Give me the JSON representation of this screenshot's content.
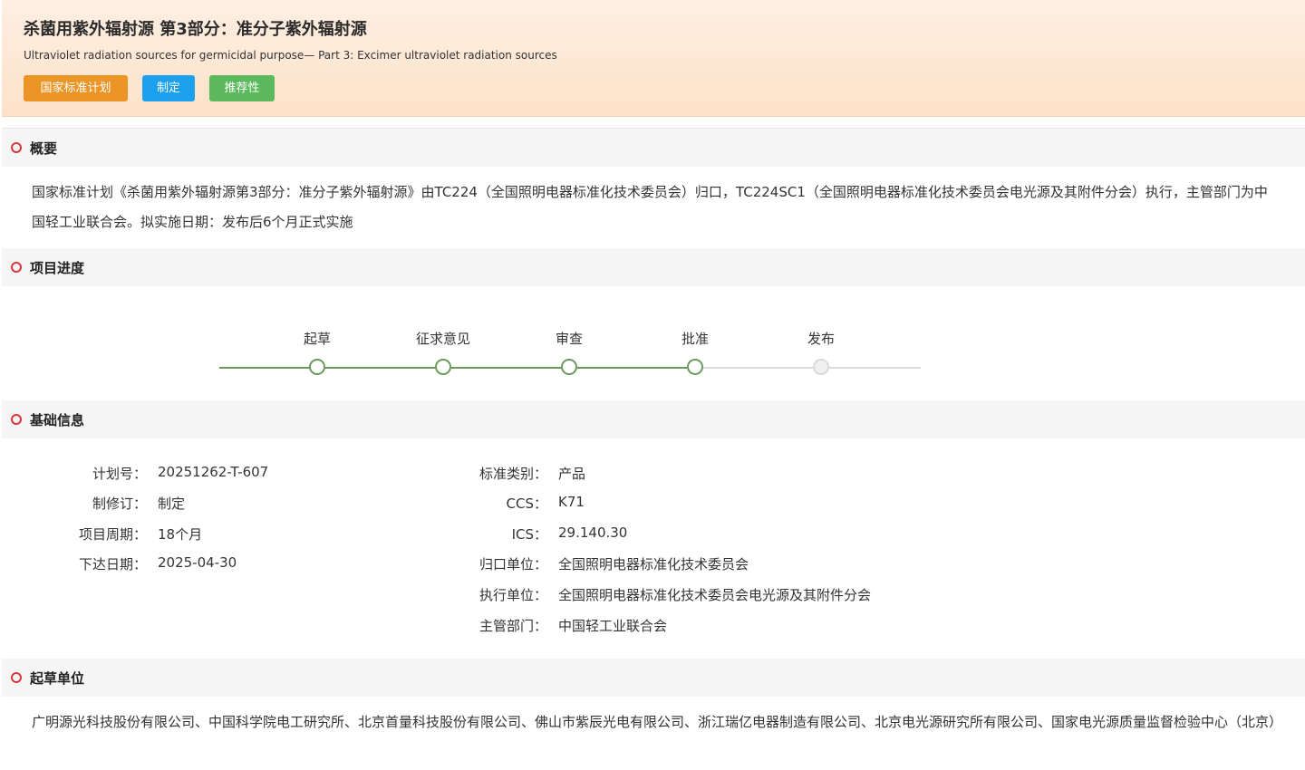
{
  "header": {
    "title": "杀菌用紫外辐射源 第3部分：准分子紫外辐射源",
    "subtitle": "Ultraviolet radiation sources for germicidal purpose— Part 3: Excimer ultraviolet radiation sources",
    "tags": [
      "国家标准计划",
      "制定",
      "推荐性"
    ]
  },
  "overview": {
    "heading": "概要",
    "text": "国家标准计划《杀菌用紫外辐射源第3部分：准分子紫外辐射源》由TC224（全国照明电器标准化技术委员会）归口，TC224SC1（全国照明电器标准化技术委员会电光源及其附件分会）执行，主管部门为中国轻工业联合会。拟实施日期：发布后6个月正式实施"
  },
  "progress": {
    "heading": "项目进度",
    "steps": [
      "起草",
      "征求意见",
      "审查",
      "批准",
      "发布"
    ],
    "completed_steps": 4
  },
  "basic": {
    "heading": "基础信息",
    "left": [
      {
        "label": "计划号：",
        "value": "20251262-T-607"
      },
      {
        "label": "制修订：",
        "value": "制定"
      },
      {
        "label": "项目周期：",
        "value": "18个月"
      },
      {
        "label": "下达日期：",
        "value": "2025-04-30"
      }
    ],
    "right": [
      {
        "label": "标准类别：",
        "value": "产品"
      },
      {
        "label": "CCS：",
        "value": "K71"
      },
      {
        "label": "ICS：",
        "value": "29.140.30"
      },
      {
        "label": "归口单位：",
        "value": "全国照明电器标准化技术委员会"
      },
      {
        "label": "执行单位：",
        "value": "全国照明电器标准化技术委员会电光源及其附件分会"
      },
      {
        "label": "主管部门：",
        "value": "中国轻工业联合会"
      }
    ]
  },
  "drafters": {
    "heading": "起草单位",
    "text": "广明源光科技股份有限公司、中国科学院电工研究所、北京首量科技股份有限公司、佛山市紫辰光电有限公司、浙江瑞亿电器制造有限公司、北京电光源研究所有限公司、国家电光源质量监督检验中心（北京）"
  },
  "colors": {
    "accent_red": "#d9363e",
    "tag_orange": "#ea9526",
    "tag_blue": "#1da1ee",
    "tag_green": "#5cb85c",
    "progress_green": "#6b9a5c"
  }
}
